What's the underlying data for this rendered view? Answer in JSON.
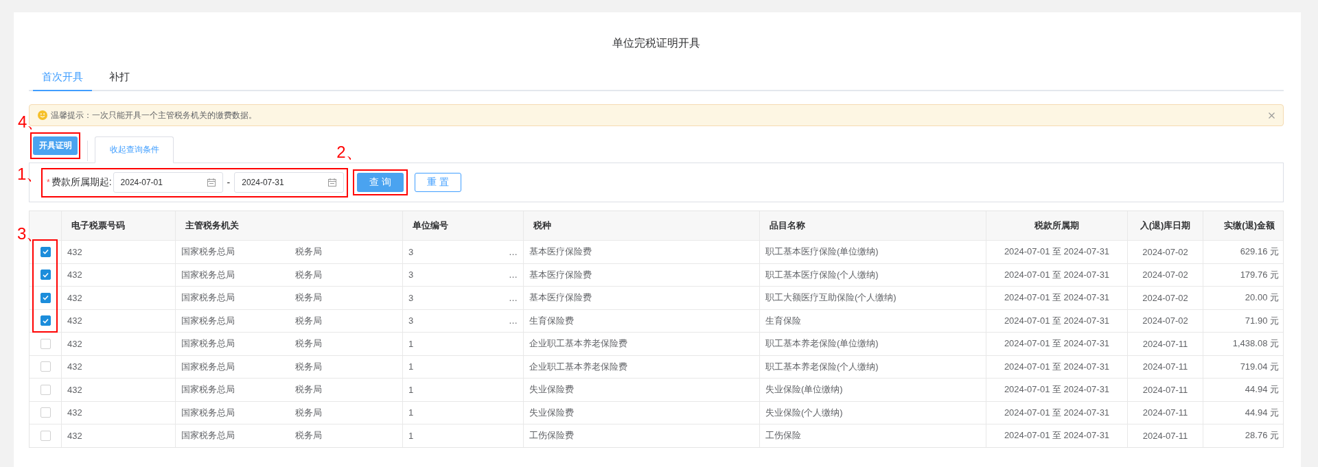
{
  "page_title": "单位完税证明开具",
  "tabs": [
    {
      "label": "首次开具",
      "selected": true
    },
    {
      "label": "补打",
      "selected": false
    }
  ],
  "notice": {
    "text": "温馨提示：一次只能开具一个主管税务机关的缴费数据。"
  },
  "toolbar": {
    "step_label": "4、",
    "issue_button": {
      "label": "开具证明",
      "highlighted": true
    },
    "collapse_tab": "收起查询条件"
  },
  "filter": {
    "step_label": "1、",
    "highlighted": true,
    "required_mark": "*",
    "label": "费款所属期起:",
    "start": "2024-07-01",
    "separator": "-",
    "end": "2024-07-31",
    "query_step_label": "2、",
    "query_button": {
      "label": "查 询",
      "highlighted": true
    },
    "reset_button": "重 置"
  },
  "table": {
    "step_label": "3、",
    "highlight_checked": true,
    "columns": [
      "电子税票号码",
      "主管税务机关",
      "单位编号",
      "税种",
      "品目名称",
      "税款所属期",
      "入(退)库日期",
      "实缴(退)金额"
    ],
    "rows": [
      {
        "selected": true,
        "ticket": "432",
        "agency": "国家税务总局",
        "agency_suffix": "税务局",
        "unit": "3",
        "unit_more": "…",
        "tax_type": "基本医疗保险费",
        "item": "职工基本医疗保险(单位缴纳)",
        "period": "2024-07-01 至 2024-07-31",
        "date": "2024-07-02",
        "amount": "629.16 元"
      },
      {
        "selected": true,
        "ticket": "432",
        "agency": "国家税务总局",
        "agency_suffix": "税务局",
        "unit": "3",
        "unit_more": "…",
        "tax_type": "基本医疗保险费",
        "item": "职工基本医疗保险(个人缴纳)",
        "period": "2024-07-01 至 2024-07-31",
        "date": "2024-07-02",
        "amount": "179.76 元"
      },
      {
        "selected": true,
        "ticket": "432",
        "agency": "国家税务总局",
        "agency_suffix": "税务局",
        "unit": "3",
        "unit_more": "…",
        "tax_type": "基本医疗保险费",
        "item": "职工大额医疗互助保险(个人缴纳)",
        "period": "2024-07-01 至 2024-07-31",
        "date": "2024-07-02",
        "amount": "20.00 元"
      },
      {
        "selected": true,
        "ticket": "432",
        "agency": "国家税务总局",
        "agency_suffix": "税务局",
        "unit": "3",
        "unit_more": "…",
        "tax_type": "生育保险费",
        "item": "生育保险",
        "period": "2024-07-01 至 2024-07-31",
        "date": "2024-07-02",
        "amount": "71.90 元"
      },
      {
        "selected": false,
        "ticket": "432",
        "agency": "国家税务总局",
        "agency_suffix": "税务局",
        "unit": "1",
        "tax_type": "企业职工基本养老保险费",
        "item": "职工基本养老保险(单位缴纳)",
        "period": "2024-07-01 至 2024-07-31",
        "date": "2024-07-11",
        "amount": "1,438.08 元"
      },
      {
        "selected": false,
        "ticket": "432",
        "agency": "国家税务总局",
        "agency_suffix": "税务局",
        "unit": "1",
        "tax_type": "企业职工基本养老保险费",
        "item": "职工基本养老保险(个人缴纳)",
        "period": "2024-07-01 至 2024-07-31",
        "date": "2024-07-11",
        "amount": "719.04 元"
      },
      {
        "selected": false,
        "ticket": "432",
        "agency": "国家税务总局",
        "agency_suffix": "税务局",
        "unit": "1",
        "tax_type": "失业保险费",
        "item": "失业保险(单位缴纳)",
        "period": "2024-07-01 至 2024-07-31",
        "date": "2024-07-11",
        "amount": "44.94 元"
      },
      {
        "selected": false,
        "ticket": "432",
        "agency": "国家税务总局",
        "agency_suffix": "税务局",
        "unit": "1",
        "tax_type": "失业保险费",
        "item": "失业保险(个人缴纳)",
        "period": "2024-07-01 至 2024-07-31",
        "date": "2024-07-11",
        "amount": "44.94 元"
      },
      {
        "selected": false,
        "ticket": "432",
        "agency": "国家税务总局",
        "agency_suffix": "税务局",
        "unit": "1",
        "tax_type": "工伤保险费",
        "item": "工伤保险",
        "period": "2024-07-01 至 2024-07-31",
        "date": "2024-07-11",
        "amount": "28.76 元"
      }
    ]
  }
}
